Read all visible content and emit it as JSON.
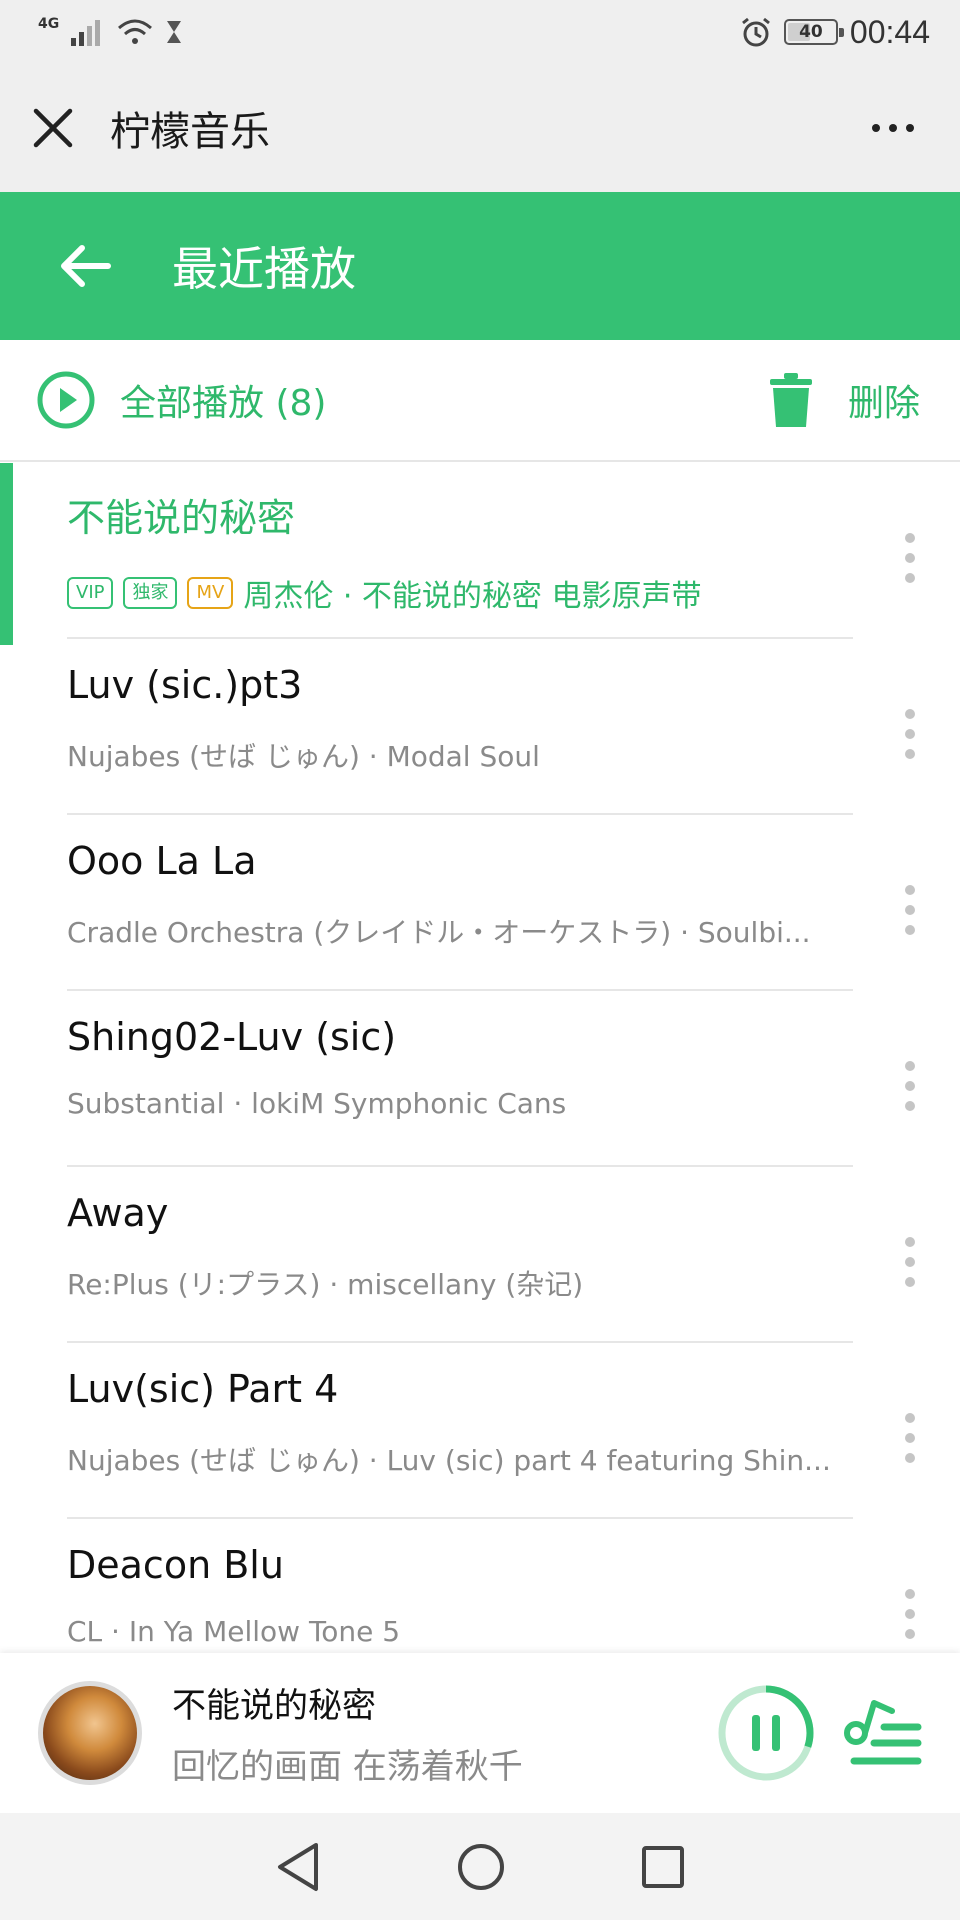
{
  "status_bar": {
    "network": "4G",
    "battery": "40",
    "time": "00:44"
  },
  "mini_program": {
    "title": "柠檬音乐"
  },
  "header": {
    "title": "最近播放"
  },
  "actions": {
    "play_all_label": "全部播放",
    "play_all_count": "(8)",
    "delete_label": "删除"
  },
  "songs": [
    {
      "title": "不能说的秘密",
      "tags": [
        "VIP",
        "独家",
        "MV"
      ],
      "subtitle": "周杰伦 · 不能说的秘密 电影原声带",
      "playing": true
    },
    {
      "title": "Luv (sic.)pt3",
      "subtitle": "Nujabes (せば じゅん) · Modal Soul"
    },
    {
      "title": "Ooo La La",
      "subtitle": "Cradle Orchestra (クレイドル・オーケストラ) · Soulbi..."
    },
    {
      "title": "Shing02-Luv (sic)",
      "subtitle": "Substantial · lokiM Symphonic Cans"
    },
    {
      "title": "Away",
      "subtitle": "Re:Plus (リ:プラス) · miscellany (杂记)"
    },
    {
      "title": "Luv(sic) Part 4",
      "subtitle": "Nujabes (せば じゅん) · Luv (sic) part 4 featuring Shin..."
    },
    {
      "title": "Deacon Blu",
      "subtitle": "CL · In Ya Mellow Tone 5"
    }
  ],
  "player": {
    "title": "不能说的秘密",
    "lyric": "回忆的画面 在荡着秋千",
    "progress": 0.3
  },
  "colors": {
    "accent": "#35c174",
    "accent_text": "#2fb86b",
    "mv_tag": "#e6a417"
  }
}
